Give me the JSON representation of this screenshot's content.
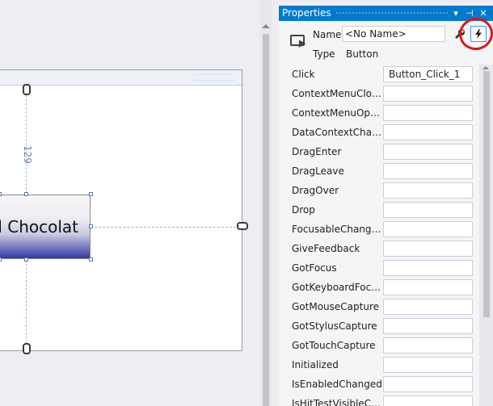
{
  "designer": {
    "button_content": "d Chocolat",
    "margin_value": "129"
  },
  "properties": {
    "title": "Properties",
    "name_label": "Name",
    "name_value": "<No Name>",
    "type_label": "Type",
    "type_value": "Button",
    "title_buttons": {
      "dropdown": "▾",
      "pin": "⊣",
      "close": "✕"
    },
    "events": [
      {
        "name": "Click",
        "value": "Button_Click_1"
      },
      {
        "name": "ContextMenuClosi...",
        "value": ""
      },
      {
        "name": "ContextMenuOpe...",
        "value": ""
      },
      {
        "name": "DataContextChang...",
        "value": ""
      },
      {
        "name": "DragEnter",
        "value": ""
      },
      {
        "name": "DragLeave",
        "value": ""
      },
      {
        "name": "DragOver",
        "value": ""
      },
      {
        "name": "Drop",
        "value": ""
      },
      {
        "name": "FocusableChanged",
        "value": ""
      },
      {
        "name": "GiveFeedback",
        "value": ""
      },
      {
        "name": "GotFocus",
        "value": ""
      },
      {
        "name": "GotKeyboardFocus",
        "value": ""
      },
      {
        "name": "GotMouseCapture",
        "value": ""
      },
      {
        "name": "GotStylusCapture",
        "value": ""
      },
      {
        "name": "GotTouchCapture",
        "value": ""
      },
      {
        "name": "Initialized",
        "value": ""
      },
      {
        "name": "IsEnabledChanged",
        "value": ""
      },
      {
        "name": "IsHitTestVisibleCh...",
        "value": ""
      }
    ]
  },
  "icons": {
    "element": "element-picker-icon",
    "properties": "wrench-icon",
    "events": "lightning-bolt-icon"
  },
  "colors": {
    "accent": "#007acc",
    "highlight_ring": "#e0161b",
    "button_gradient_bottom": "#3137a6"
  }
}
